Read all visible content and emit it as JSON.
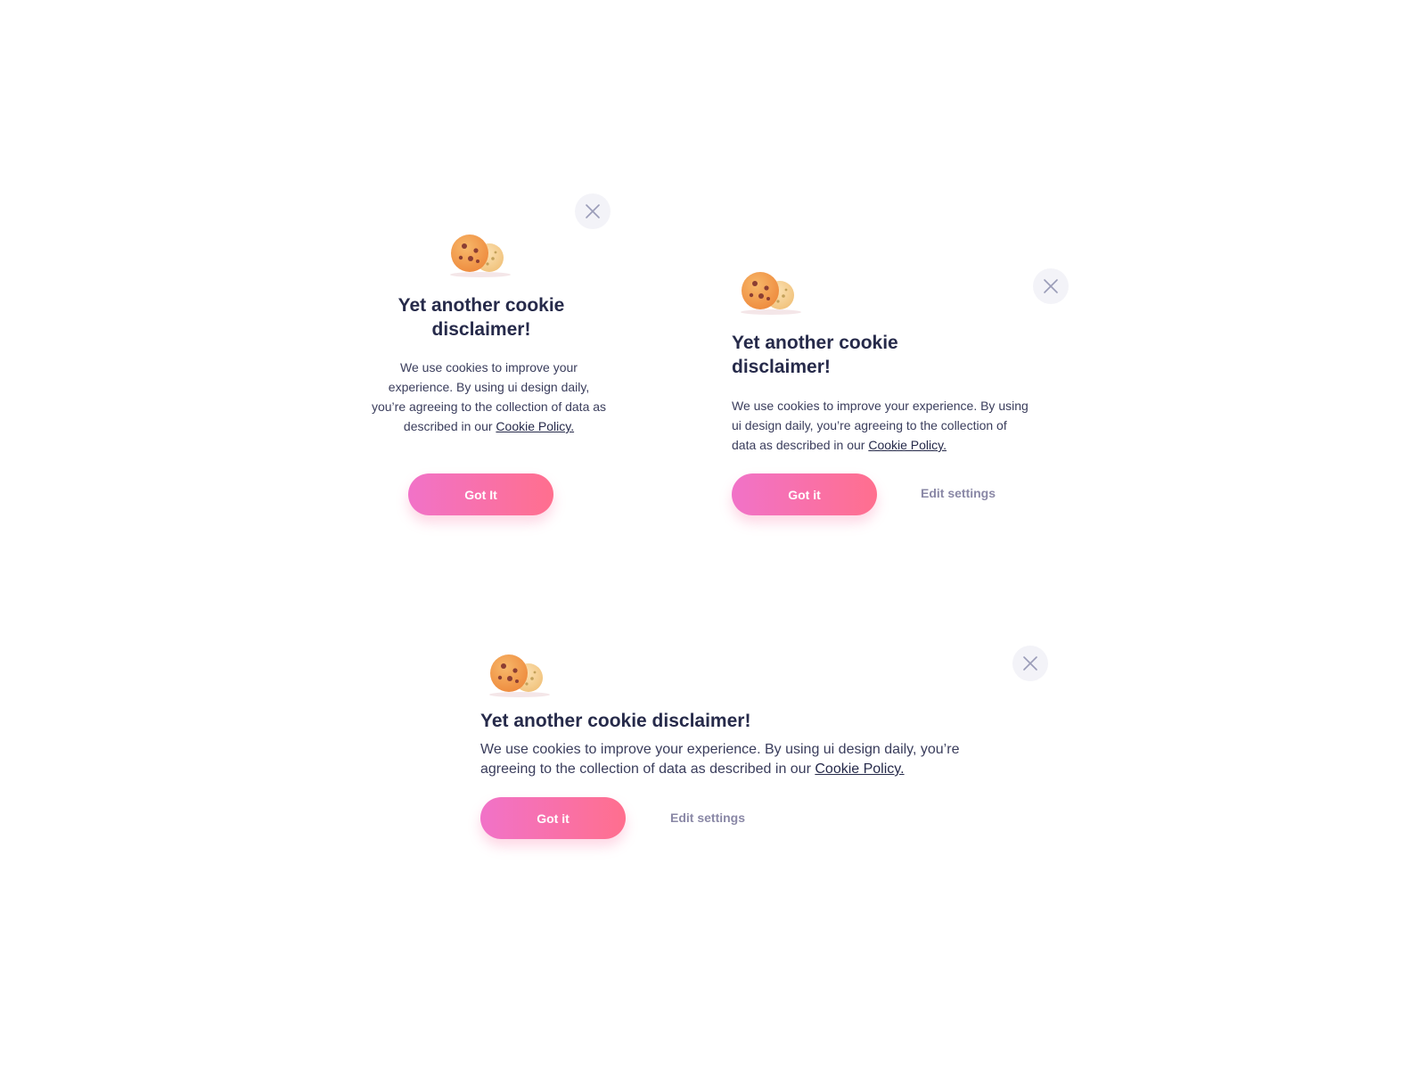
{
  "icons": {
    "close": "close-icon",
    "cookie": "cookies-icon"
  },
  "colors": {
    "button_gradient_start": "#f172c8",
    "button_gradient_end": "#ff6f8e",
    "title": "#262a4a",
    "secondary_link": "#8a88a6",
    "close_bg": "#f3f3f8"
  },
  "card_centered": {
    "title": "Yet another cookie disclaimer!",
    "body": "We use cookies to improve your experience. By using ui design daily, you’re agreeing to the collection of data as described in our",
    "link": "Cookie Policy.",
    "primary_label": "Got It"
  },
  "card_left": {
    "title": "Yet another cookie disclaimer!",
    "body": "We use cookies to improve your experience. By using ui design daily, you’re agreeing to the collection of data as described in our",
    "link": "Cookie Policy.",
    "primary_label": "Got it",
    "secondary_label": "Edit settings"
  },
  "card_wide": {
    "title": "Yet another cookie disclaimer!",
    "body": "We use cookies to improve your experience. By using ui design daily, you’re agreeing to the collection of data as described in our",
    "link": "Cookie Policy.",
    "primary_label": "Got it",
    "secondary_label": "Edit settings"
  }
}
